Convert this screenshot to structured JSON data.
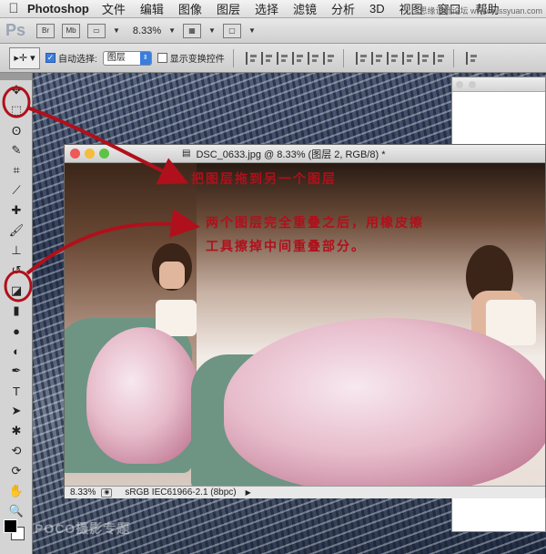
{
  "menubar": {
    "app_name": "Photoshop",
    "items": [
      "文件",
      "编辑",
      "图像",
      "图层",
      "选择",
      "滤镜",
      "分析",
      "3D",
      "视图",
      "窗口",
      "帮助"
    ],
    "watermark": "思缘设计论坛 www.missyuan.com"
  },
  "appbar": {
    "logo": "Ps",
    "btn_bridge": "Br",
    "btn_mini": "Mb",
    "zoom": "8.33%"
  },
  "options": {
    "auto_select_label": "自动选择:",
    "auto_select_checked": true,
    "auto_select_value": "图层",
    "transform_label": "显示变换控件",
    "transform_checked": false
  },
  "document": {
    "title": "DSC_0633.jpg @ 8.33% (图层 2, RGB/8) *",
    "status_zoom": "8.33%",
    "status_profile": "sRGB IEC61966-2.1 (8bpc)"
  },
  "annotations": {
    "line1": "把图层拖到另一个图层",
    "line2": "两个图层完全重叠之后，用橡皮擦",
    "line3": "工具擦掉中间重叠部分。",
    "color": "#b0101b"
  },
  "watermark": "POCO摄影专题",
  "tools": [
    "move-tool",
    "marquee-tool",
    "lasso-tool",
    "quick-select-tool",
    "crop-tool",
    "eyedropper-tool",
    "healing-brush-tool",
    "brush-tool",
    "clone-stamp-tool",
    "history-brush-tool",
    "eraser-tool",
    "gradient-tool",
    "blur-tool",
    "dodge-tool",
    "pen-tool",
    "type-tool",
    "path-select-tool",
    "shape-tool",
    "3d-rotate-tool",
    "3d-orbit-tool",
    "hand-tool",
    "zoom-tool"
  ]
}
